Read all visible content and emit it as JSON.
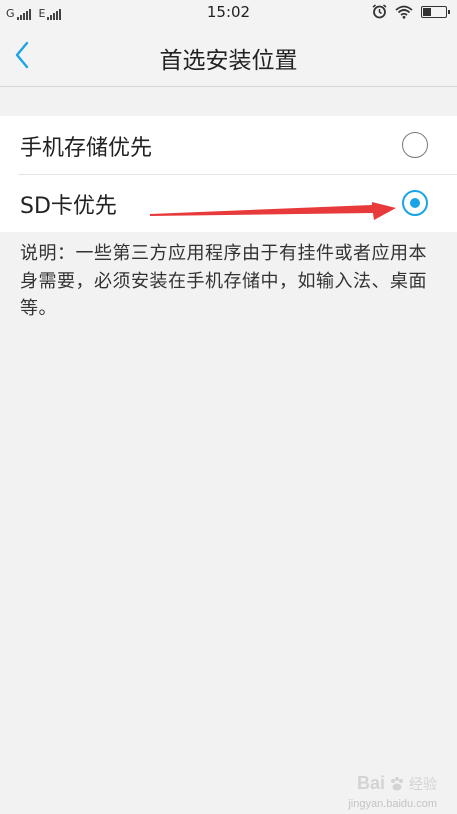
{
  "status_bar": {
    "carrier1": "G",
    "carrier2": "E",
    "time": "15:02",
    "icons": [
      "signal-icon",
      "signal-icon",
      "alarm-icon",
      "wifi-icon",
      "battery-icon"
    ]
  },
  "header": {
    "back_icon": "chevron-left-icon",
    "title": "首选安装位置"
  },
  "options": [
    {
      "label": "手机存储优先",
      "selected": false
    },
    {
      "label": "SD卡优先",
      "selected": true
    }
  ],
  "description": "说明：一些第三方应用程序由于有挂件或者应用本身需要，必须安装在手机存储中，如输入法、桌面等。",
  "watermark": {
    "brand": "Bai",
    "brand_suffix": "经验",
    "url": "jingyan.baidu.com"
  },
  "colors": {
    "accent": "#1aa4e8",
    "annotation_arrow": "#e8393b",
    "background": "#f2f2f2"
  }
}
